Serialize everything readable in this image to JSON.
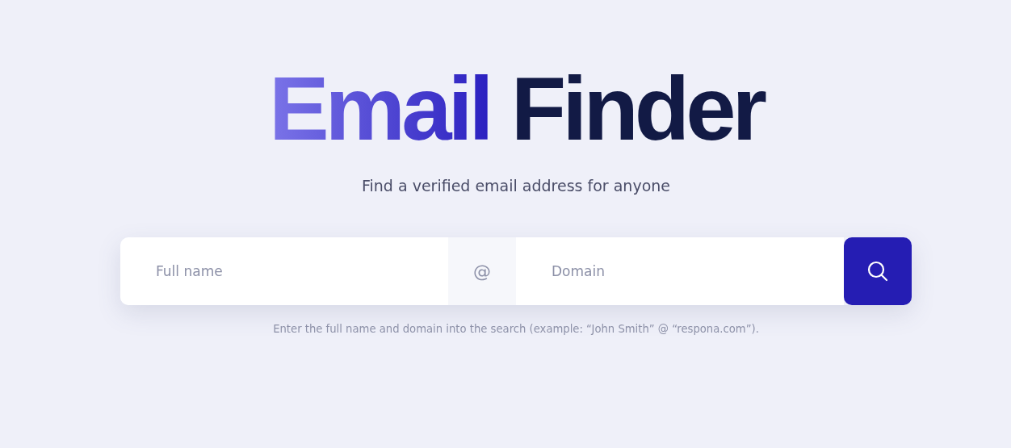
{
  "title": {
    "highlight": "Email",
    "rest": "Finder"
  },
  "subtitle": "Find a verified email address for anyone",
  "search": {
    "name_placeholder": "Full name",
    "separator": "@",
    "domain_placeholder": "Domain"
  },
  "hint": "Enter the full name and domain into the search (example: “John Smith” @ “respona.com”)."
}
